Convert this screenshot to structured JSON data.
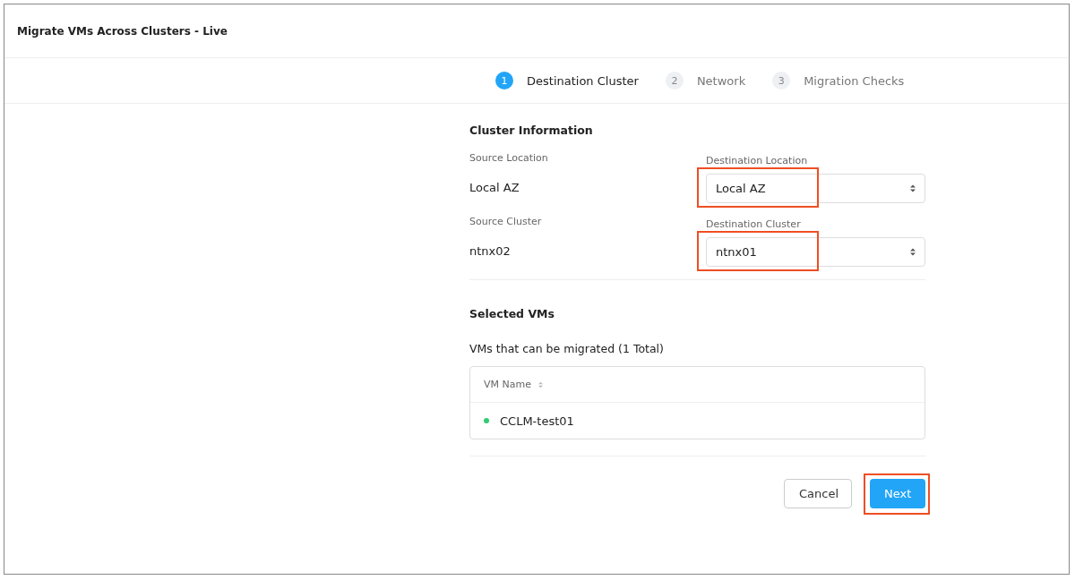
{
  "window": {
    "title": "Migrate VMs Across Clusters - Live"
  },
  "steps": [
    {
      "number": "1",
      "label": "Destination Cluster",
      "selected": true
    },
    {
      "number": "2",
      "label": "Network",
      "selected": false
    },
    {
      "number": "3",
      "label": "Migration Checks",
      "selected": false
    }
  ],
  "cluster_information": {
    "heading": "Cluster Information",
    "rows": [
      {
        "source_label": "Source Location",
        "source_value": "Local AZ",
        "destination_label": "Destination Location",
        "destination_value": "Local AZ",
        "highlighted": true
      },
      {
        "source_label": "Source Cluster",
        "source_value": "ntnx02",
        "destination_label": "Destination Cluster",
        "destination_value": "ntnx01",
        "highlighted": true
      }
    ]
  },
  "selected_vms": {
    "heading": "Selected VMs",
    "caption": "VMs that can be migrated (1 Total)",
    "columns": [
      "VM Name"
    ],
    "rows": [
      {
        "name": "CCLM-test01",
        "color": "#2ecc71"
      }
    ]
  },
  "buttons": [
    {
      "label": "Cancel",
      "kind": "secondary",
      "highlighted": false
    },
    {
      "label": "Next",
      "kind": "primary",
      "highlighted": true
    }
  ]
}
